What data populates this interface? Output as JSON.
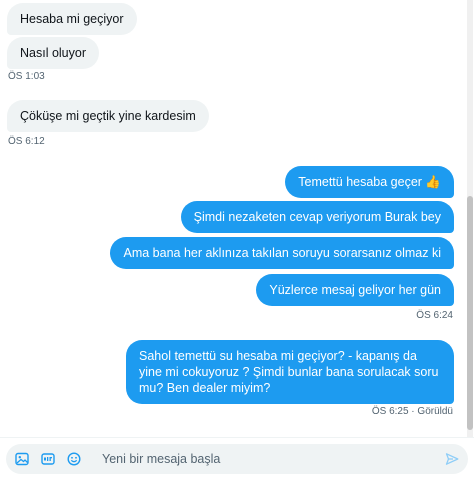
{
  "thread": {
    "messages": [
      {
        "text": "Hesaba mi geçiyor",
        "dir": "in"
      },
      {
        "text": "Nasıl oluyor",
        "dir": "in"
      },
      {
        "text": "Çöküşe mi geçtik yine kardesim",
        "dir": "in"
      },
      {
        "text": "Temettü hesaba geçer 👍",
        "dir": "out"
      },
      {
        "text": "Şimdi nezaketen cevap veriyorum Burak bey",
        "dir": "out"
      },
      {
        "text": "Ama bana her aklınıza takılan soruyu sorarsanız olmaz ki",
        "dir": "out"
      },
      {
        "text": "Yüzlerce mesaj geliyor her gün",
        "dir": "out"
      },
      {
        "text": "Sahol temettü su hesaba mi geçiyor? - kapanış da yine mi cokuyoruz ? Şimdi bunlar bana sorulacak soru mu? Ben dealer miyim?",
        "dir": "out"
      }
    ],
    "timestamps": [
      {
        "text": "ÖS 1:03"
      },
      {
        "text": "ÖS 6:12"
      },
      {
        "text": "ÖS 6:24"
      },
      {
        "text": "ÖS 6:25 · Görüldü"
      }
    ]
  },
  "composer": {
    "placeholder": "Yeni bir mesaja başla",
    "icons": [
      "image-icon",
      "gif-icon",
      "emoji-icon",
      "send-icon"
    ]
  },
  "colors": {
    "accent": "#1d9bf0",
    "incoming_bg": "#eff3f4",
    "muted_text": "#536471"
  }
}
